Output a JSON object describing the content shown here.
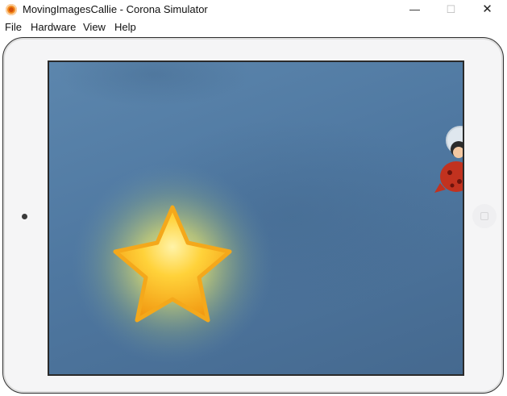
{
  "window": {
    "title": "MovingImagesCallie - Corona Simulator",
    "icon": "corona-simulator-icon",
    "controls": {
      "minimize": "—",
      "maximize": "☐",
      "close": "✕"
    }
  },
  "menubar": {
    "items": [
      {
        "label": "File"
      },
      {
        "label": "Hardware"
      },
      {
        "label": "View"
      },
      {
        "label": "Help"
      }
    ]
  },
  "simulator": {
    "device": "tablet",
    "screen": {
      "background_colors": [
        "#5c86ad",
        "#45698f"
      ],
      "sprites": [
        {
          "name": "glowing-star",
          "color": "#f7b421"
        },
        {
          "name": "callie-astronaut-character",
          "color": "#c2321f"
        }
      ]
    }
  }
}
